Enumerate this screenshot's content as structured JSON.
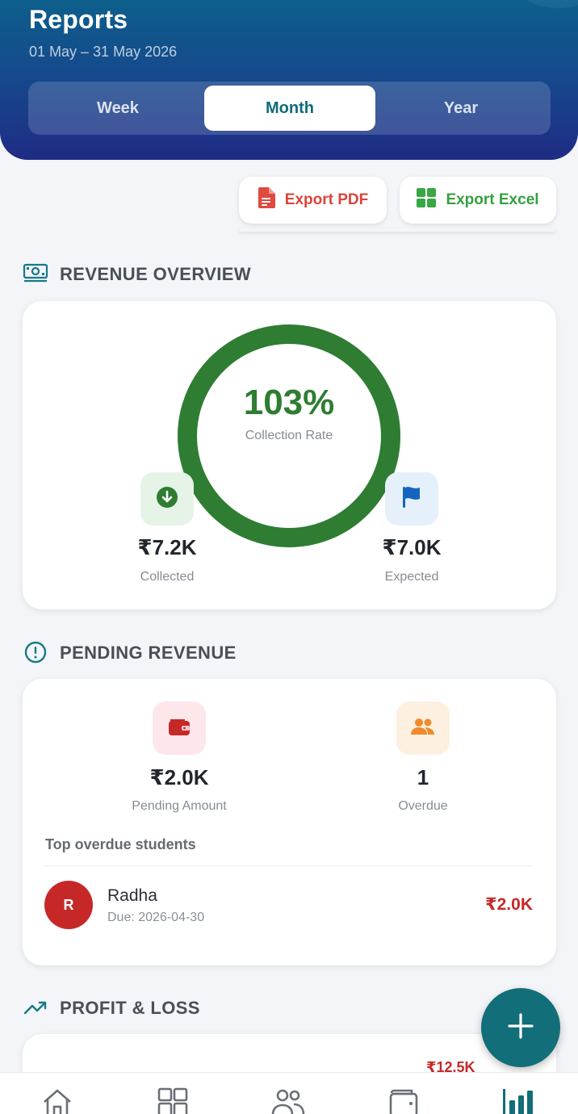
{
  "header": {
    "title": "Reports",
    "date_range": "01 May – 31 May 2026",
    "periods": [
      "Week",
      "Month",
      "Year"
    ],
    "selected_period": "Month"
  },
  "actions": {
    "export_pdf": "Export PDF",
    "export_excel": "Export Excel"
  },
  "revenue_overview": {
    "title": "REVENUE OVERVIEW",
    "collection_rate": "103%",
    "collection_rate_label": "Collection Rate",
    "collected_value": "₹7.2K",
    "collected_label": "Collected",
    "expected_value": "₹7.0K",
    "expected_label": "Expected",
    "ring_fill_fraction": 1.0
  },
  "pending_revenue": {
    "title": "PENDING REVENUE",
    "pending_amount": "₹2.0K",
    "pending_label": "Pending Amount",
    "overdue_count": "1",
    "overdue_label": "Overdue",
    "top_overdue_heading": "Top overdue students",
    "students": [
      {
        "initial": "R",
        "name": "Radha",
        "due": "Due: 2026-04-30",
        "amount": "₹2.0K"
      }
    ]
  },
  "profit_loss": {
    "title": "PROFIT & LOSS",
    "visible_amount": "₹12.5K"
  },
  "icons": {
    "export_pdf": "pdf-file-icon",
    "export_excel": "excel-grid-icon",
    "revenue": "cash-icon",
    "pending": "alert-circle-icon",
    "profit_loss": "trending-up-icon",
    "collected": "arrow-down-circle-icon",
    "expected": "flag-icon",
    "pending_amount": "wallet-icon",
    "overdue": "people-icon",
    "fab": "plus-icon",
    "nav": [
      "home-icon",
      "grid-icon",
      "students-icon",
      "wallet-icon",
      "reports-icon"
    ]
  },
  "colors": {
    "header_top": "#0d5f8c",
    "header_bottom": "#1f2c85",
    "accent_teal": "#126e78",
    "ring_green": "#2e7d32",
    "danger_red": "#c62828",
    "excel_green": "#35a041",
    "pdf_red": "#d9453b"
  }
}
